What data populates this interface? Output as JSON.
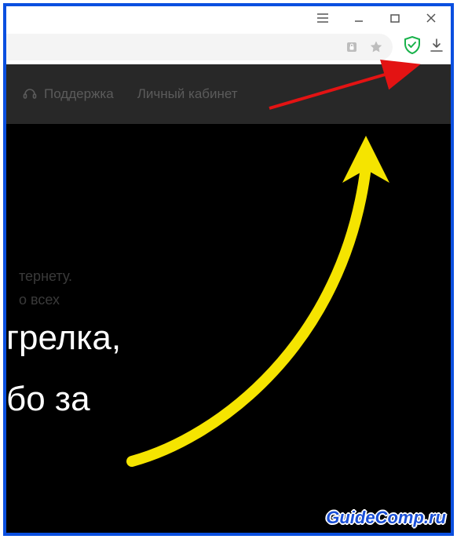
{
  "window": {
    "menu_icon": "hamburger",
    "minimize_icon": "minimize",
    "maximize_icon": "maximize",
    "close_icon": "close"
  },
  "toolbar": {
    "lock_icon": "lock",
    "star_icon": "star",
    "shield_icon": "adguard-shield",
    "download_icon": "download"
  },
  "nav": {
    "support_icon": "headset",
    "support_label": "Поддержка",
    "account_label": "Личный кабинет"
  },
  "faded": {
    "line1": "тернету.",
    "line2": "о всех"
  },
  "headline": {
    "line1": "грелка,",
    "line2": "бо за"
  },
  "annotation": {
    "red_arrow": "red-arrow",
    "yellow_arrow": "yellow-arrow"
  },
  "watermark": "GuideComp.ru",
  "colors": {
    "frame": "#0a4fe0",
    "shield": "#19b24b",
    "arrow_yellow": "#f5e400",
    "arrow_red": "#e31313"
  }
}
